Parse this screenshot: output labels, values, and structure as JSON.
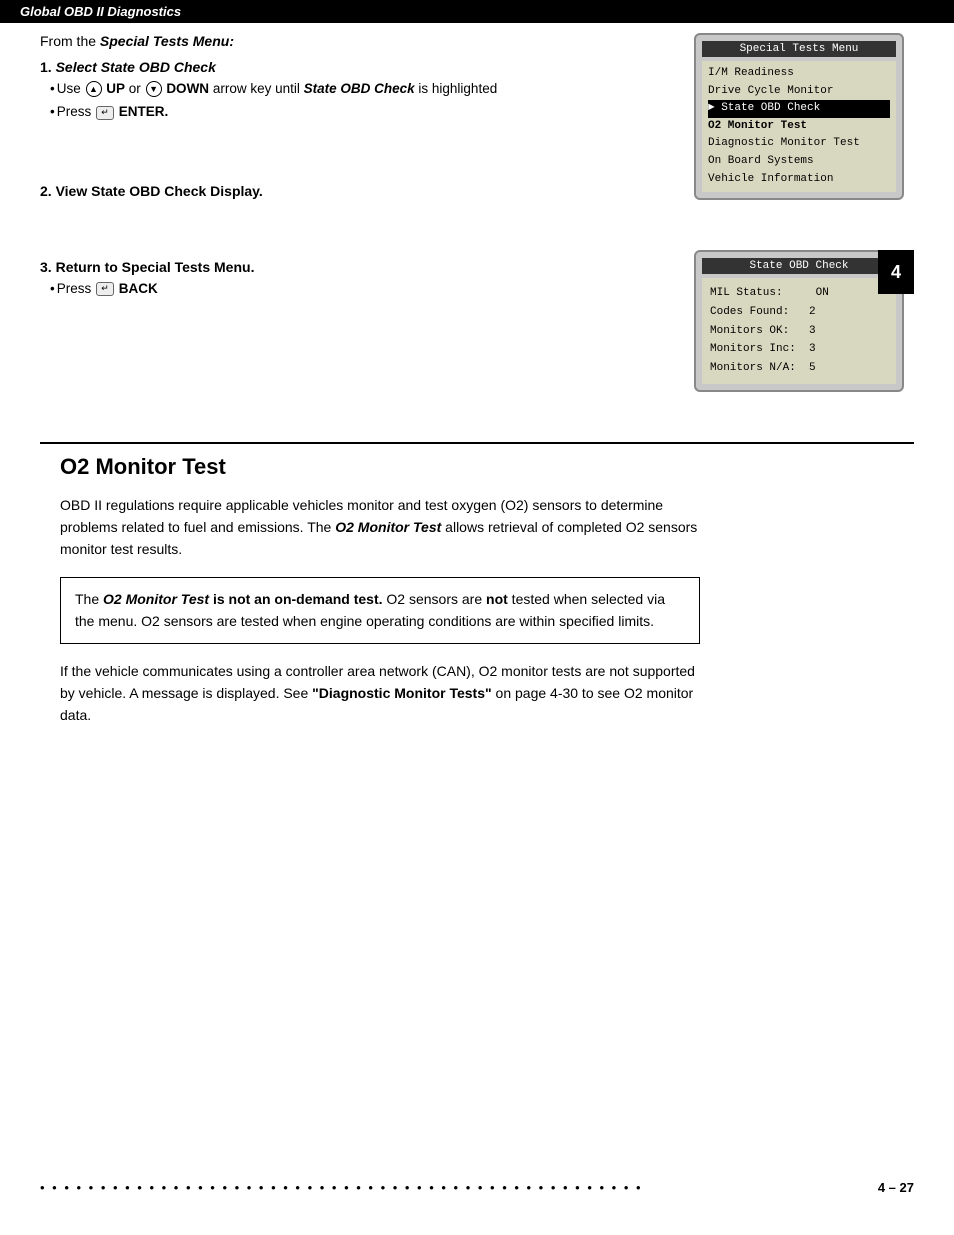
{
  "header": {
    "title": "Global OBD II Diagnostics"
  },
  "steps_intro": {
    "from_label": "From the ",
    "menu_name": "Special Tests Menu:"
  },
  "steps": [
    {
      "number": "1.",
      "title": "Select State OBD Check",
      "details": [
        {
          "type": "arrow_instruction",
          "text_prefix": "Use ",
          "up_label": "UP",
          "or_text": " or ",
          "down_label": "DOWN",
          "text_suffix": " arrow key until ",
          "bold_italic": "State OBD Check",
          "text_end": " is highlighted"
        },
        {
          "type": "enter_instruction",
          "text": "Press ",
          "action": "ENTER."
        }
      ]
    },
    {
      "number": "2.",
      "title": "View State OBD Check Display."
    },
    {
      "number": "3.",
      "title": "Return to Special Tests Menu.",
      "details": [
        {
          "type": "back_instruction",
          "text": "Press ",
          "action": "BACK"
        }
      ]
    }
  ],
  "screen1": {
    "title": "Special Tests Menu",
    "items": [
      "I/M Readiness",
      "Drive Cycle Monitor",
      "State OBD Check",
      "O2 Monitor Test",
      "Diagnostic Monitor Test",
      "On Board Systems",
      "Vehicle Information"
    ],
    "highlighted_index": 2
  },
  "screen2": {
    "title": "State OBD Check",
    "rows": [
      {
        "label": "MIL Status:",
        "value": "ON"
      },
      {
        "label": "Codes Found:",
        "value": "2"
      },
      {
        "label": "Monitors OK:",
        "value": "3"
      },
      {
        "label": "Monitors Inc:",
        "value": "3"
      },
      {
        "label": "Monitors N/A:",
        "value": "5"
      }
    ]
  },
  "tab_badge": "4",
  "o2_section": {
    "title": "O2 Monitor Test",
    "para1": "OBD II regulations require applicable vehicles monitor and test oxygen (O2) sensors to determine problems related to fuel and emissions. The O2 Monitor Test allows retrieval of completed O2 sensors monitor test results.",
    "para1_bold_italic": "O2 Monitor Test",
    "note": {
      "prefix": "The ",
      "bold_italic": "O2 Monitor Test",
      "middle": " is not an on-demand test.",
      "rest": " O2 sensors are not tested when selected via the menu. O2 sensors are tested when engine operating conditions are within specified limits.",
      "not_bold": "not"
    },
    "para2_text": "If the vehicle communicates using a controller area network (CAN), O2 monitor tests are not supported by vehicle. A message is displayed. See ",
    "para2_bold": "\"Diagnostic Monitor Tests\"",
    "para2_end": " on page 4-30 to see O2 monitor data."
  },
  "footer": {
    "dots": "• • • • • • • • • • • • • • • • • • • • • • • • • • • • • • • • • • • • • • • • • • • • • • • • • •",
    "page_number": "4 – 27"
  }
}
